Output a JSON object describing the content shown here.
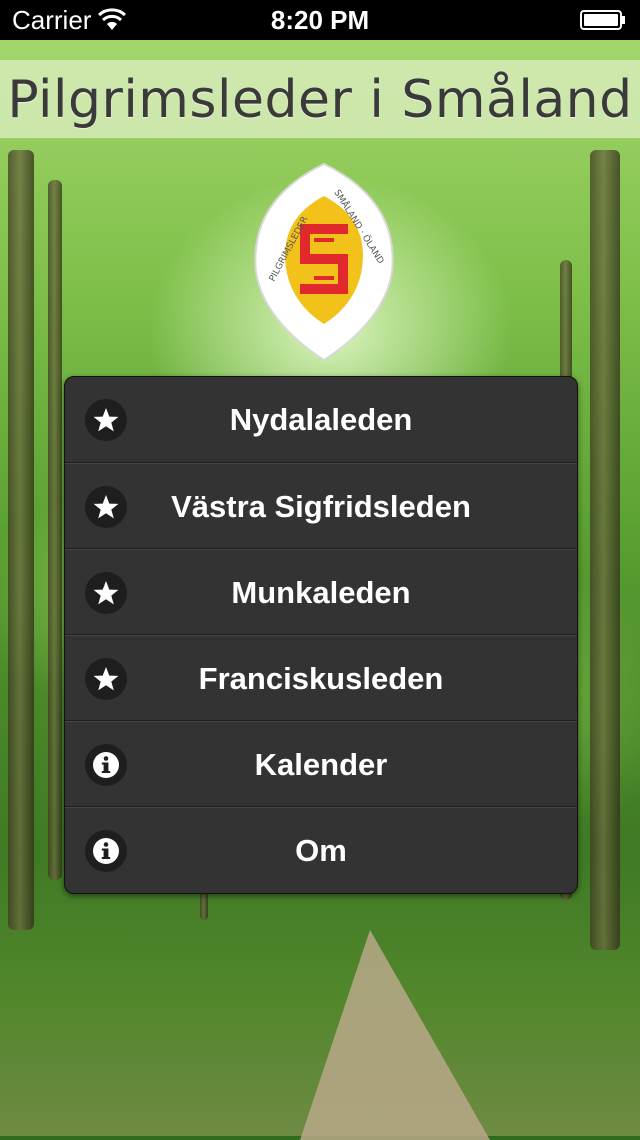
{
  "status_bar": {
    "carrier": "Carrier",
    "time": "8:20 PM"
  },
  "header": {
    "title": "Pilgrimsleder i Småland"
  },
  "logo": {
    "text_left": "PILGRIMSLEDER",
    "text_right": "SMÅLAND · ÖLAND",
    "letter": "S",
    "colors": {
      "gold": "#f2c21a",
      "red": "#e0282d",
      "rim": "#ffffff"
    }
  },
  "menu": {
    "items": [
      {
        "label": "Nydalaleden",
        "icon": "star-icon"
      },
      {
        "label": "Västra Sigfridsleden",
        "icon": "star-icon"
      },
      {
        "label": "Munkaleden",
        "icon": "star-icon"
      },
      {
        "label": "Franciskusleden",
        "icon": "star-icon"
      },
      {
        "label": "Kalender",
        "icon": "info-icon"
      },
      {
        "label": "Om",
        "icon": "info-icon"
      }
    ]
  }
}
